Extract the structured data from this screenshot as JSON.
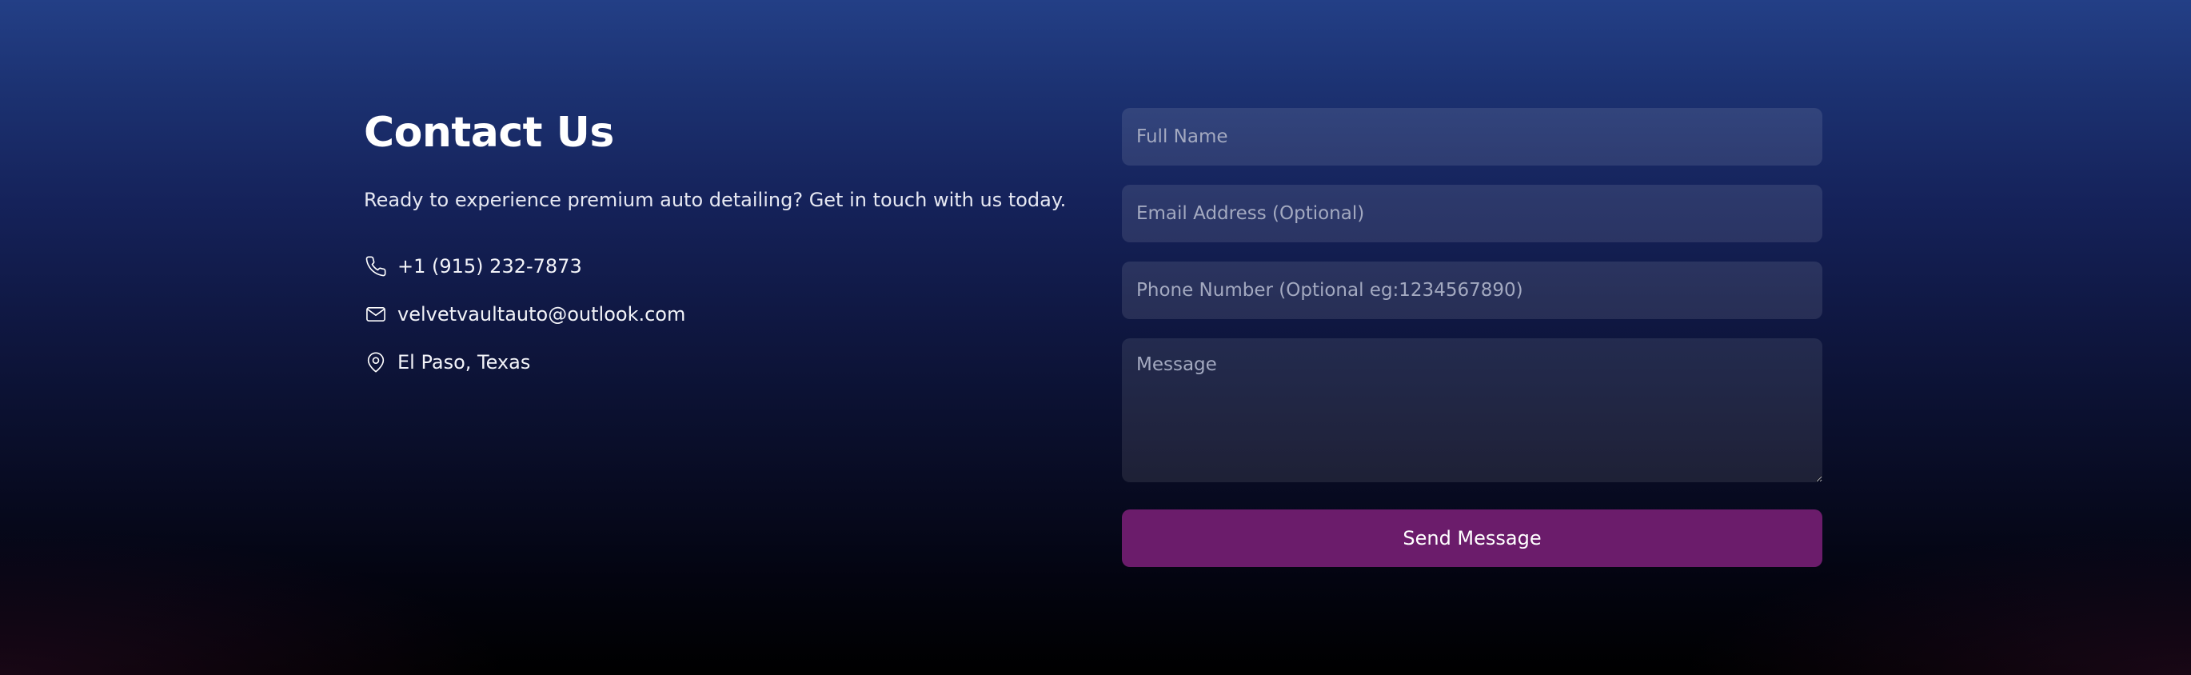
{
  "contact": {
    "title": "Contact Us",
    "subtitle": "Ready to experience premium auto detailing? Get in touch with us today.",
    "info": [
      {
        "icon": "phone-icon",
        "text": "+1 (915) 232-7873"
      },
      {
        "icon": "mail-icon",
        "text": "velvetvaultauto@outlook.com"
      },
      {
        "icon": "map-pin-icon",
        "text": "El Paso, Texas"
      }
    ]
  },
  "form": {
    "full_name_placeholder": "Full Name",
    "email_placeholder": "Email Address (Optional)",
    "phone_placeholder": "Phone Number (Optional eg:1234567890)",
    "message_placeholder": "Message",
    "submit_label": "Send Message"
  },
  "colors": {
    "background_top": "#233f86",
    "background_bottom": "#000000",
    "button": "#6b1c6b",
    "text": "#ffffff"
  }
}
